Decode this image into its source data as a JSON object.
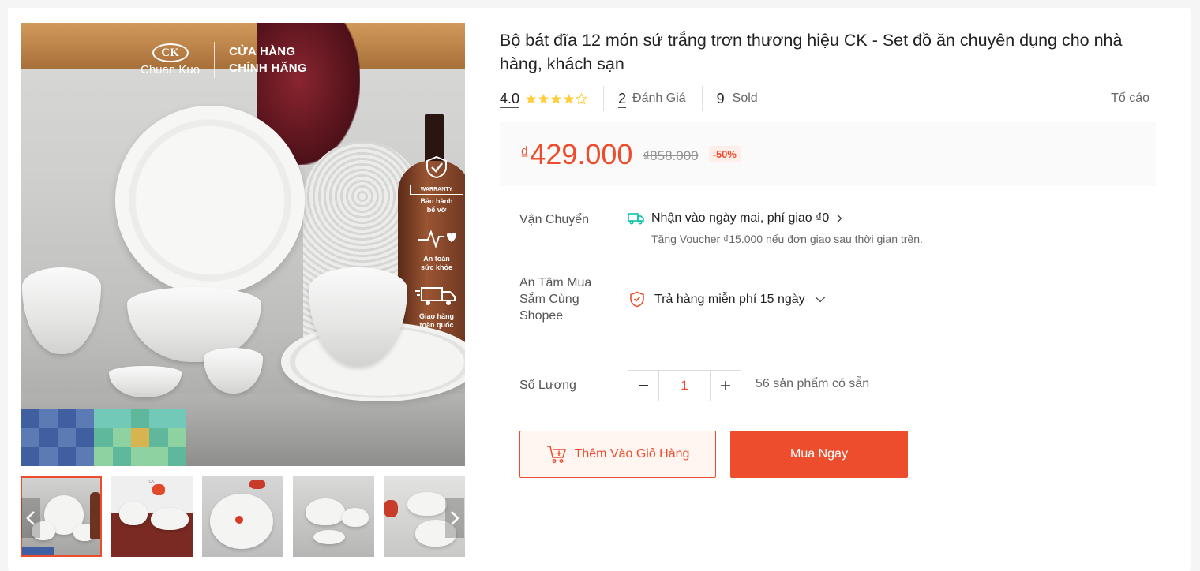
{
  "gallery": {
    "logo_badge": "CK",
    "logo_brand": "Chuan Kuo",
    "store_line1": "CỬA HÀNG",
    "store_line2": "CHÍNH HÃNG",
    "warranty_label": "WARRANTY",
    "badges": [
      {
        "line1": "Bảo hành",
        "line2": "bể vỡ",
        "icon": "shield-check-icon"
      },
      {
        "line1": "An toàn",
        "line2": "sức khỏe",
        "icon": "health-heart-icon"
      },
      {
        "line1": "Giao hàng",
        "line2": "toàn quốc",
        "icon": "delivery-truck-icon"
      }
    ],
    "thumbnail_count": 5
  },
  "product": {
    "title": "Bộ bát đĩa 12 món sứ trắng trơn thương hiệu CK - Set đồ ăn chuyên dụng cho nhà hàng, khách sạn",
    "rating": "4.0",
    "stars_filled": 4,
    "stars_total": 5,
    "reviews_count": "2",
    "reviews_label": "Đánh Giá",
    "sold_count": "9",
    "sold_label": "Sold",
    "report_label": "Tố cáo"
  },
  "price": {
    "currency_symbol": "₫",
    "current": "429.000",
    "original": "₫858.000",
    "discount": "-50%"
  },
  "shipping": {
    "label": "Vận Chuyển",
    "main": "Nhận vào ngày mai, phí giao ₫0",
    "sub": "Tặng Voucher ₫15.000 nếu đơn giao sau thời gian trên."
  },
  "assurance": {
    "label_line1": "An Tâm Mua",
    "label_line2": "Sắm Cùng",
    "label_line3": "Shopee",
    "text": "Trả hàng miễn phí 15 ngày"
  },
  "quantity": {
    "label": "Số Lượng",
    "value": "1",
    "stock": "56 sản phẩm có sẵn"
  },
  "actions": {
    "add_to_cart": "Thêm Vào Giỏ Hàng",
    "buy_now": "Mua Ngay"
  },
  "colors": {
    "accent": "#ee4d2d",
    "star": "#ffce3d",
    "shipping_icon": "#00bfa5"
  }
}
